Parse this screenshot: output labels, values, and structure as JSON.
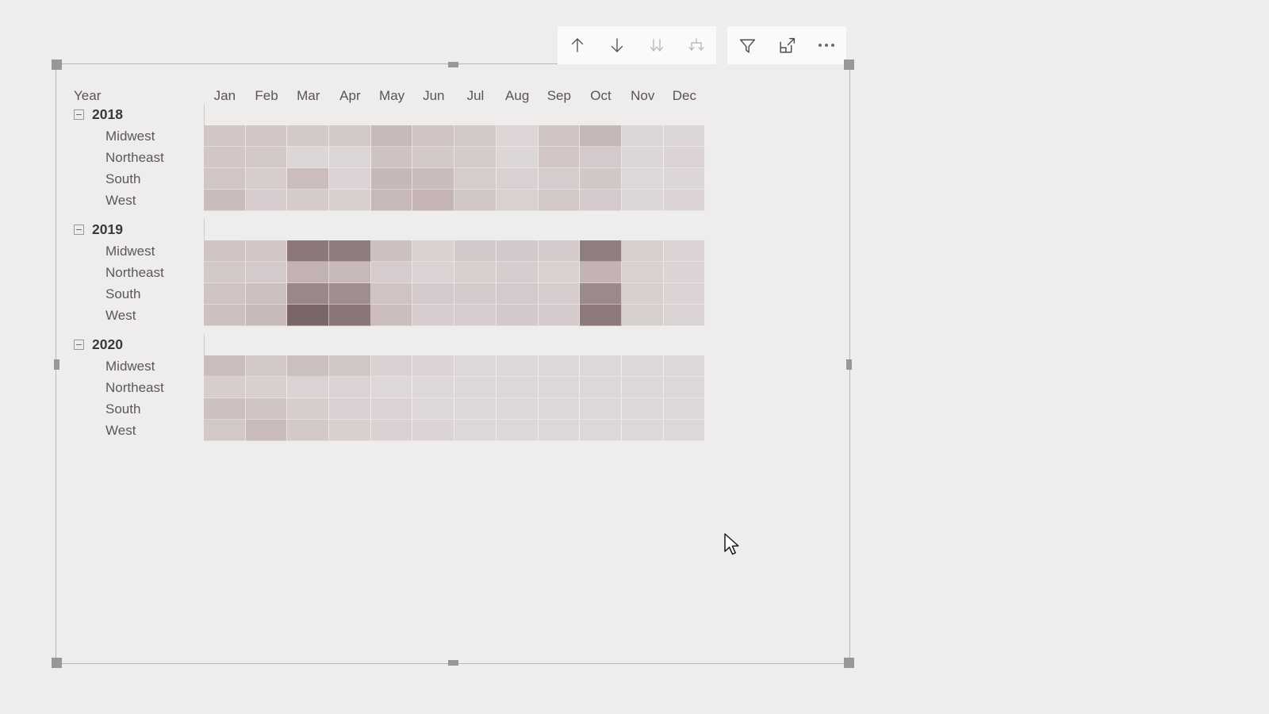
{
  "visual": {
    "type": "matrix-heatmap",
    "row_header_title": "Year",
    "background": "#efecec",
    "selected": true
  },
  "toolbar": {
    "buttons": [
      {
        "name": "drill-up-icon",
        "label": "Drill up",
        "enabled": true
      },
      {
        "name": "drill-down-arrow-icon",
        "label": "Drill down",
        "enabled": true
      },
      {
        "name": "expand-all-icon",
        "label": "Expand all down one level in the hierarchy",
        "enabled": false
      },
      {
        "name": "drill-on-hierarchy-icon",
        "label": "Go to the next level in the hierarchy",
        "enabled": false
      },
      {
        "name": "filter-icon",
        "label": "Filters",
        "enabled": true
      },
      {
        "name": "focus-mode-icon",
        "label": "Focus mode",
        "enabled": true
      },
      {
        "name": "more-options-icon",
        "label": "More options",
        "enabled": true
      }
    ]
  },
  "chart_data": {
    "type": "heatmap",
    "title": "",
    "xlabel": "",
    "ylabel": "Year",
    "categories": [
      "Jan",
      "Feb",
      "Mar",
      "Apr",
      "May",
      "Jun",
      "Jul",
      "Aug",
      "Sep",
      "Oct",
      "Nov",
      "Dec"
    ],
    "row_groups": [
      {
        "year": "2018",
        "expanded": true,
        "rows": [
          {
            "region": "Midwest",
            "colors": [
              "#d2c6c6",
              "#d2c6c6",
              "#d4c9c9",
              "#d4c9c9",
              "#c8b9ba",
              "#cfc3c4",
              "#d3c8c8",
              "#ddd5d5",
              "#d0c4c5",
              "#c6b7b8",
              "#ddd6d6",
              "#ddd6d6"
            ]
          },
          {
            "region": "Northeast",
            "colors": [
              "#d2c6c6",
              "#d3c8c8",
              "#ddd6d6",
              "#ddd6d6",
              "#cec2c3",
              "#d4c9c9",
              "#d5cbcb",
              "#ddd6d6",
              "#d1c5c6",
              "#d5cacb",
              "#ddd6d6",
              "#dbd3d3"
            ]
          },
          {
            "region": "South",
            "colors": [
              "#d1c5c5",
              "#d7cdcd",
              "#cbbdbe",
              "#dcd4d4",
              "#c6b7b8",
              "#cabbbd",
              "#d6cccc",
              "#d9d1d1",
              "#d6cccd",
              "#d2c7c7",
              "#ded7d7",
              "#ddd6d6"
            ]
          },
          {
            "region": "West",
            "colors": [
              "#cabbbc",
              "#d6cccd",
              "#d5cbcb",
              "#d8cfcf",
              "#c7b8b9",
              "#c5b5b7",
              "#d2c7c7",
              "#d9d0d0",
              "#d3c8c8",
              "#d5cacb",
              "#ddd6d6",
              "#dcd4d4"
            ]
          }
        ]
      },
      {
        "year": "2019",
        "expanded": true,
        "rows": [
          {
            "region": "Midwest",
            "colors": [
              "#cfc3c4",
              "#d1c5c5",
              "#8c7878",
              "#8e7b7b",
              "#cdc0c1",
              "#d9d0d0",
              "#d4c9ca",
              "#d4c9ca",
              "#d6cbcc",
              "#907d7d",
              "#d8cfcf",
              "#dcd4d4"
            ]
          },
          {
            "region": "Northeast",
            "colors": [
              "#d3c8c8",
              "#d5cacb",
              "#c2b2b3",
              "#c7b8b9",
              "#d6cccd",
              "#dbd3d3",
              "#d8cfcf",
              "#d7cdce",
              "#d9d0d0",
              "#c3b3b5",
              "#d9d0d0",
              "#dcd4d4"
            ]
          },
          {
            "region": "South",
            "colors": [
              "#cfc3c4",
              "#cdc0c1",
              "#9a8787",
              "#a08e8e",
              "#cfc3c4",
              "#d5cacb",
              "#d6cbcc",
              "#d5cacb",
              "#d6cccd",
              "#9c8989",
              "#d8cfcf",
              "#dcd4d4"
            ]
          },
          {
            "region": "West",
            "colors": [
              "#cdc0c1",
              "#c8b9ba",
              "#7a6667",
              "#8a7677",
              "#cbbdbe",
              "#d7cdce",
              "#d6cccd",
              "#d4c9ca",
              "#d6cbcc",
              "#8e7a7b",
              "#d8cfcf",
              "#dbd3d3"
            ]
          }
        ]
      },
      {
        "year": "2020",
        "expanded": true,
        "rows": [
          {
            "region": "Midwest",
            "colors": [
              "#cbbdbe",
              "#d4c9c9",
              "#ccbfc0",
              "#d2c7c7",
              "#dad1d2",
              "#dcd4d4",
              "#ded7d7",
              "#ded7d7",
              "#ded7d7",
              "#ded7d7",
              "#ded7d7",
              "#ded7d7"
            ]
          },
          {
            "region": "Northeast",
            "colors": [
              "#d7cdcd",
              "#d8cfcf",
              "#dbd3d3",
              "#dbd3d3",
              "#ded7d7",
              "#ded7d7",
              "#ded7d7",
              "#ded7d7",
              "#ded7d7",
              "#ded7d7",
              "#ded7d7",
              "#ded7d7"
            ]
          },
          {
            "region": "South",
            "colors": [
              "#cdc0c1",
              "#cfc3c4",
              "#d7cdcd",
              "#dad1d2",
              "#dbd3d3",
              "#ded7d7",
              "#ded7d7",
              "#ded7d7",
              "#ded7d7",
              "#ded7d7",
              "#ded7d7",
              "#ded7d7"
            ]
          },
          {
            "region": "West",
            "colors": [
              "#d3c8c8",
              "#c9babb",
              "#d4c9c9",
              "#d8cfcf",
              "#dad1d2",
              "#dcd4d4",
              "#ded7d7",
              "#ded7d7",
              "#ded7d7",
              "#ded7d7",
              "#ded7d7",
              "#ded7d7"
            ]
          }
        ]
      }
    ],
    "color_scale": {
      "min": "#ded7d7",
      "max": "#7a6667"
    },
    "grid": true,
    "legend_position": "none"
  }
}
